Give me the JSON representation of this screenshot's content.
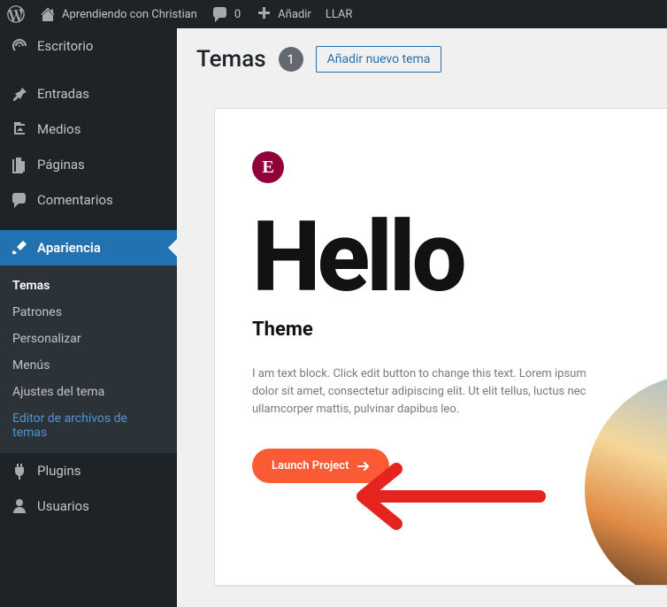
{
  "adminbar": {
    "site_name": "Aprendiendo con Christian",
    "comments_count": "0",
    "add_new": "Añadir",
    "llar": "LLAR"
  },
  "sidebar": {
    "items": [
      {
        "label": "Escritorio"
      },
      {
        "label": "Entradas"
      },
      {
        "label": "Medios"
      },
      {
        "label": "Páginas"
      },
      {
        "label": "Comentarios"
      },
      {
        "label": "Apariencia"
      },
      {
        "label": "Plugins"
      },
      {
        "label": "Usuarios"
      }
    ],
    "appearance_submenu": [
      {
        "label": "Temas"
      },
      {
        "label": "Patrones"
      },
      {
        "label": "Personalizar"
      },
      {
        "label": "Menús"
      },
      {
        "label": "Ajustes del tema"
      },
      {
        "label": "Editor de archivos de temas"
      }
    ]
  },
  "main": {
    "title": "Temas",
    "count": "1",
    "add_button": "Añadir nuevo tema"
  },
  "theme_card": {
    "hello": "Hello",
    "subtitle": "Theme",
    "description": "I am text block. Click edit button to change this text. Lorem ipsum dolor sit amet, consectetur adipiscing elit. Ut elit tellus, luctus nec ullamcorper mattis, pulvinar dapibus leo.",
    "launch": "Launch Project",
    "badge_letter": "E"
  }
}
